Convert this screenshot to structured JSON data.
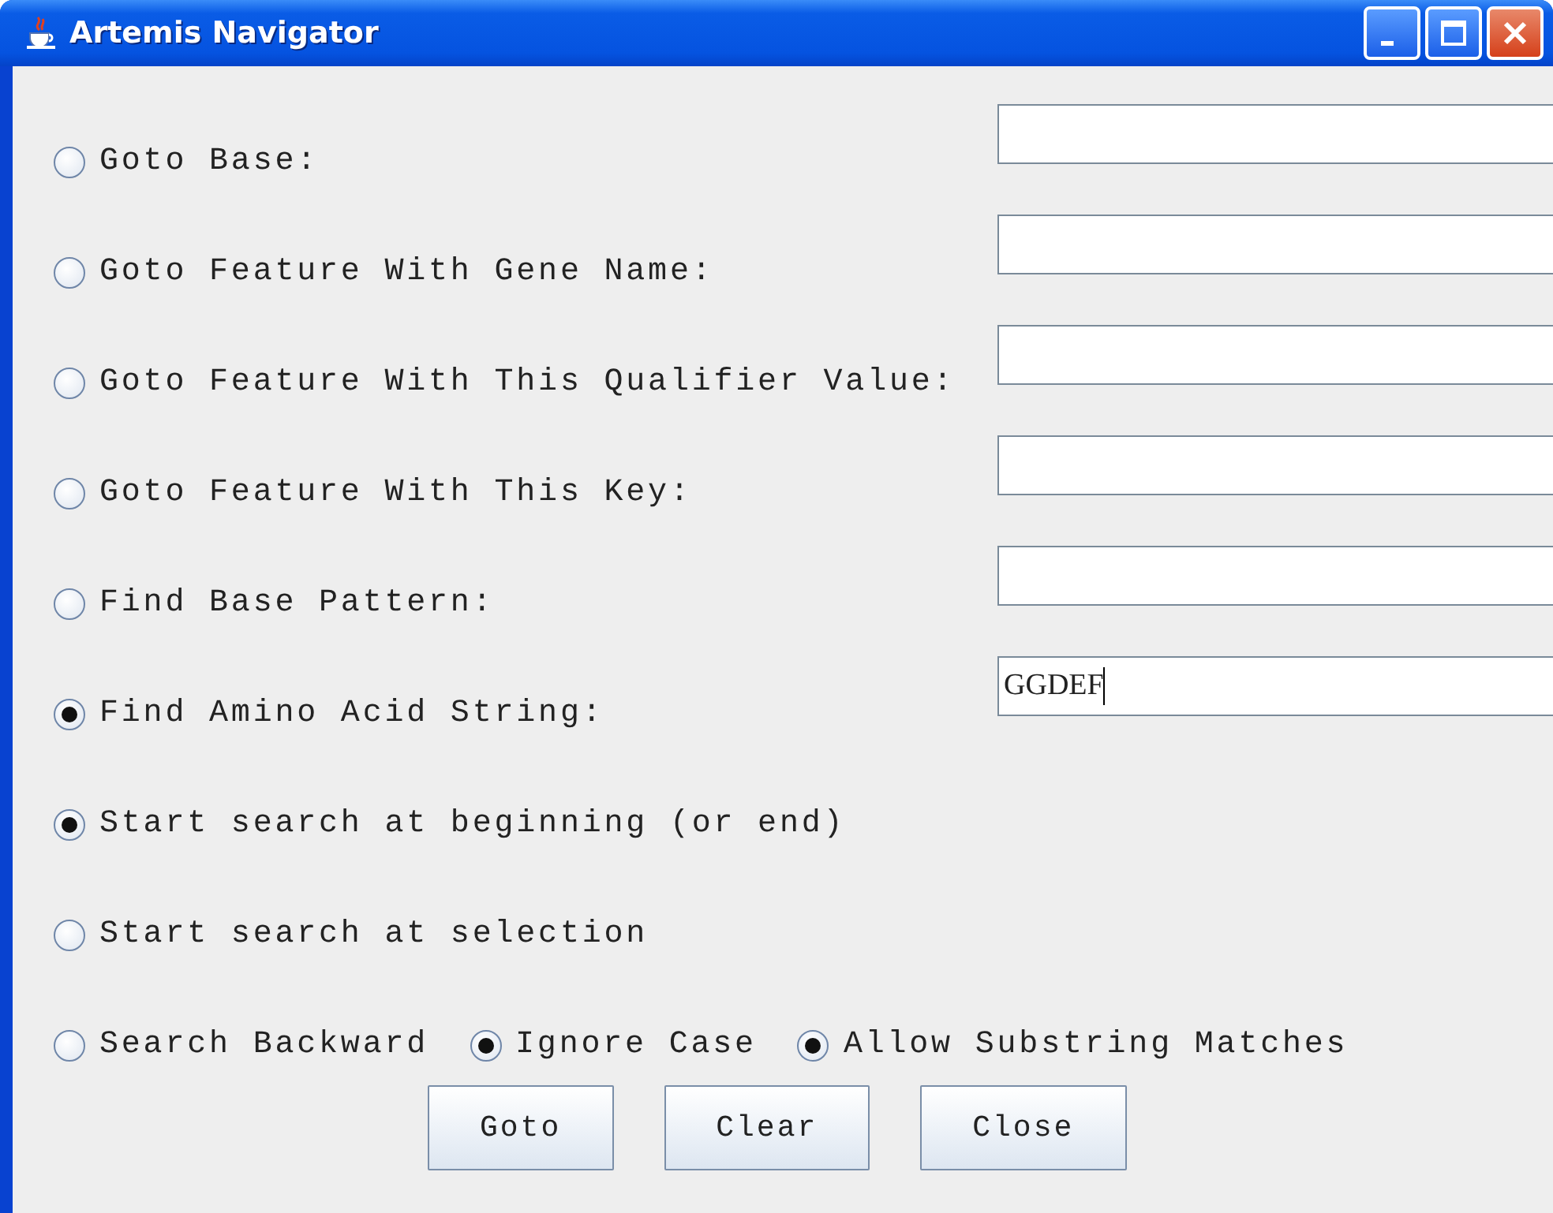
{
  "window": {
    "title": "Artemis Navigator"
  },
  "search_rows": [
    {
      "label": "Goto Base:",
      "selected": false
    },
    {
      "label": "Goto Feature With Gene Name:",
      "selected": false
    },
    {
      "label": "Goto Feature With This Qualifier Value:",
      "selected": false
    },
    {
      "label": "Goto Feature With This Key:",
      "selected": false
    },
    {
      "label": "Find Base Pattern:",
      "selected": false
    },
    {
      "label": "Find Amino Acid String:",
      "selected": true,
      "value": "GGDEF"
    }
  ],
  "start_options": [
    {
      "label": "Start search at beginning (or end)",
      "selected": true
    },
    {
      "label": "Start search at selection",
      "selected": false
    }
  ],
  "flags": [
    {
      "label": "Search Backward",
      "checked": false
    },
    {
      "label": "Ignore Case",
      "checked": true
    },
    {
      "label": "Allow Substring Matches",
      "checked": true
    }
  ],
  "buttons": [
    "Goto",
    "Clear",
    "Close"
  ]
}
